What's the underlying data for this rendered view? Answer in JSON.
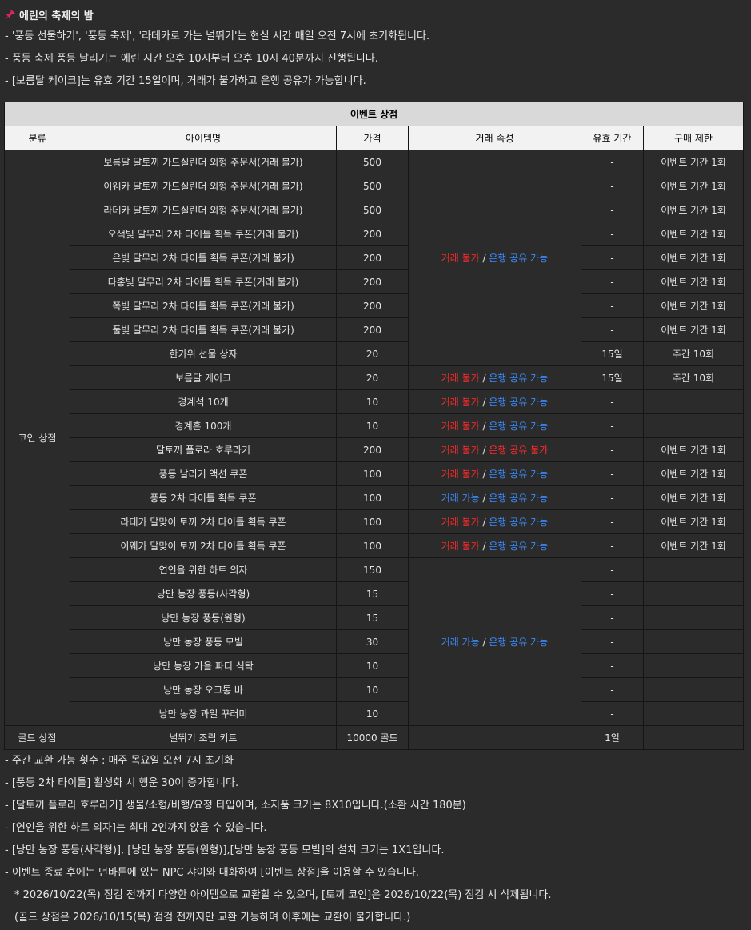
{
  "title": "에린의 축제의 밤",
  "notes_top": [
    "- '풍등 선물하기', '풍등 축제', '라데카로 가는 널뛰기'는 현실 시간 매일 오전 7시에 초기화됩니다.",
    "- 풍등 축제 풍등 날리기는 에린 시간 오후 10시부터 오후 10시 40분까지 진행됩니다.",
    "- [보름달 케이크]는 유효 기간 15일이며, 거래가 불가하고 은행 공유가 가능합니다."
  ],
  "table": {
    "title": "이벤트 상점",
    "headers": [
      "분류",
      "아이템명",
      "가격",
      "거래 속성",
      "유효 기간",
      "구매 제한"
    ],
    "categories": {
      "coin": "코인 상점",
      "gold": "골드 상점"
    },
    "trade": {
      "no": "거래 불가",
      "yes": "거래 가능",
      "bank_yes": "은행 공유 가능",
      "bank_no": "은행 공유 불가",
      "sep": " / "
    },
    "rows": [
      {
        "name": "보름달 달토끼 가드실린더 외형 주문서(거래 불가)",
        "price": "500",
        "period": "-",
        "limit": "이벤트 기간 1회"
      },
      {
        "name": "이웨카 달토끼 가드실린더 외형 주문서(거래 불가)",
        "price": "500",
        "period": "-",
        "limit": "이벤트 기간 1회"
      },
      {
        "name": "라데카 달토끼 가드실린더 외형 주문서(거래 불가)",
        "price": "500",
        "period": "-",
        "limit": "이벤트 기간 1회"
      },
      {
        "name": "오색빛 달무리 2차 타이틀 획득 쿠폰(거래 불가)",
        "price": "200",
        "period": "-",
        "limit": "이벤트 기간 1회"
      },
      {
        "name": "은빛 달무리 2차 타이틀 획득 쿠폰(거래 불가)",
        "price": "200",
        "period": "-",
        "limit": "이벤트 기간 1회"
      },
      {
        "name": "다홍빛 달무리 2차 타이틀 획득 쿠폰(거래 불가)",
        "price": "200",
        "period": "-",
        "limit": "이벤트 기간 1회"
      },
      {
        "name": "쪽빛 달무리 2차 타이틀 획득 쿠폰(거래 불가)",
        "price": "200",
        "period": "-",
        "limit": "이벤트 기간 1회"
      },
      {
        "name": "풀빛 달무리 2차 타이틀 획득 쿠폰(거래 불가)",
        "price": "200",
        "period": "-",
        "limit": "이벤트 기간 1회"
      },
      {
        "name": "한가위 선물 상자",
        "price": "20",
        "period": "15일",
        "limit": "주간 10회"
      },
      {
        "name": "보름달 케이크",
        "price": "20",
        "period": "15일",
        "limit": "주간 10회"
      },
      {
        "name": "경계석 10개",
        "price": "10",
        "period": "-",
        "limit": ""
      },
      {
        "name": "경계흔 100개",
        "price": "10",
        "period": "-",
        "limit": ""
      },
      {
        "name": "달토끼 플로라 호루라기",
        "price": "200",
        "period": "-",
        "limit": "이벤트 기간 1회"
      },
      {
        "name": "풍등 날리기 액션 쿠폰",
        "price": "100",
        "period": "-",
        "limit": "이벤트 기간 1회"
      },
      {
        "name": "풍등 2차 타이틀 획득 쿠폰",
        "price": "100",
        "period": "-",
        "limit": "이벤트 기간 1회"
      },
      {
        "name": "라데카 달맞이 토끼 2차 타이틀 획득 쿠폰",
        "price": "100",
        "period": "-",
        "limit": "이벤트 기간 1회"
      },
      {
        "name": "이웨카 달맞이 토끼 2차 타이틀 획득 쿠폰",
        "price": "100",
        "period": "-",
        "limit": "이벤트 기간 1회"
      },
      {
        "name": "연인을 위한 하트 의자",
        "price": "150",
        "period": "-",
        "limit": ""
      },
      {
        "name": "낭만 농장 풍등(사각형)",
        "price": "15",
        "period": "-",
        "limit": ""
      },
      {
        "name": "낭만 농장 풍등(원형)",
        "price": "15",
        "period": "-",
        "limit": ""
      },
      {
        "name": "낭만 농장 풍등 모빌",
        "price": "30",
        "period": "-",
        "limit": ""
      },
      {
        "name": "낭만 농장 가을 파티 식탁",
        "price": "10",
        "period": "-",
        "limit": ""
      },
      {
        "name": "낭만 농장 오크통 바",
        "price": "10",
        "period": "-",
        "limit": ""
      },
      {
        "name": "낭만 농장 과일 꾸러미",
        "price": "10",
        "period": "-",
        "limit": ""
      }
    ],
    "gold_row": {
      "name": "널뛰기 조립 키트",
      "price": "10000 골드",
      "trade": "",
      "period": "1일",
      "limit": ""
    }
  },
  "notes_bottom": [
    "- 주간 교환 가능 횟수 : 매주 목요일 오전 7시 초기화",
    "- [풍등 2차 타이틀] 활성화 시 행운 30이 증가합니다.",
    "- [달토끼 플로라 호루라기] 생물/소형/비행/요정 타입이며, 소지품 크기는 8X10입니다.(소환 시간 180분)",
    "- [연인을 위한 하트 의자]는 최대 2인까지 앉을 수 있습니다.",
    "- [낭만 농장 풍등(사각형)], [낭만 농장 풍등(원형)],[낭만 농장 풍등 모빌]의 설치 크기는 1X1입니다.",
    "- 이벤트 종료 후에는 던바튼에 있는 NPC 샤이와 대화하여 [이벤트 상점]을 이용할 수 있습니다.",
    "* 2026/10/22(목) 점검 전까지 다양한 아이템으로 교환할 수 있으며, [토끼 코인]은 2026/10/22(목) 점검 시 삭제됩니다.",
    "(골드 상점은 2026/10/15(목) 점검 전까지만 교환 가능하며 이후에는 교환이 불가합니다.)"
  ],
  "colors": {
    "accent_red": "#ff2b2b",
    "accent_blue": "#3e8cff",
    "pin": "#e0245e"
  }
}
